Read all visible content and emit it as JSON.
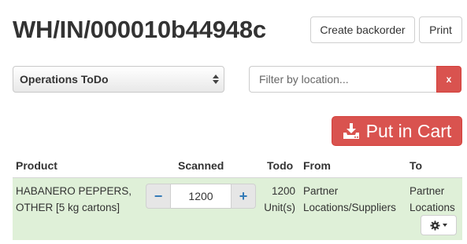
{
  "page": {
    "title": "WH/IN/000010b44948c"
  },
  "actions": {
    "create_backorder": "Create backorder",
    "print": "Print"
  },
  "operations_select": {
    "value": "Operations ToDo"
  },
  "filter": {
    "placeholder": "Filter by location...",
    "clear_label": "x"
  },
  "cart": {
    "label": "Put in Cart",
    "icon": "download-tray-icon"
  },
  "table": {
    "headers": {
      "product": "Product",
      "scanned": "Scanned",
      "todo": "Todo",
      "from": "From",
      "to": "To"
    },
    "rows": [
      {
        "product": "HABANERO PEPPERS, OTHER [5 kg cartons]",
        "scanned": "1200",
        "minus": "−",
        "plus": "+",
        "todo": "1200 Unit(s)",
        "from": "Partner Locations/Suppliers",
        "to": "Partner Locations"
      }
    ]
  },
  "colors": {
    "danger": "#d9534f",
    "row_success": "#dff0d8",
    "link_blue": "#337ab7"
  }
}
